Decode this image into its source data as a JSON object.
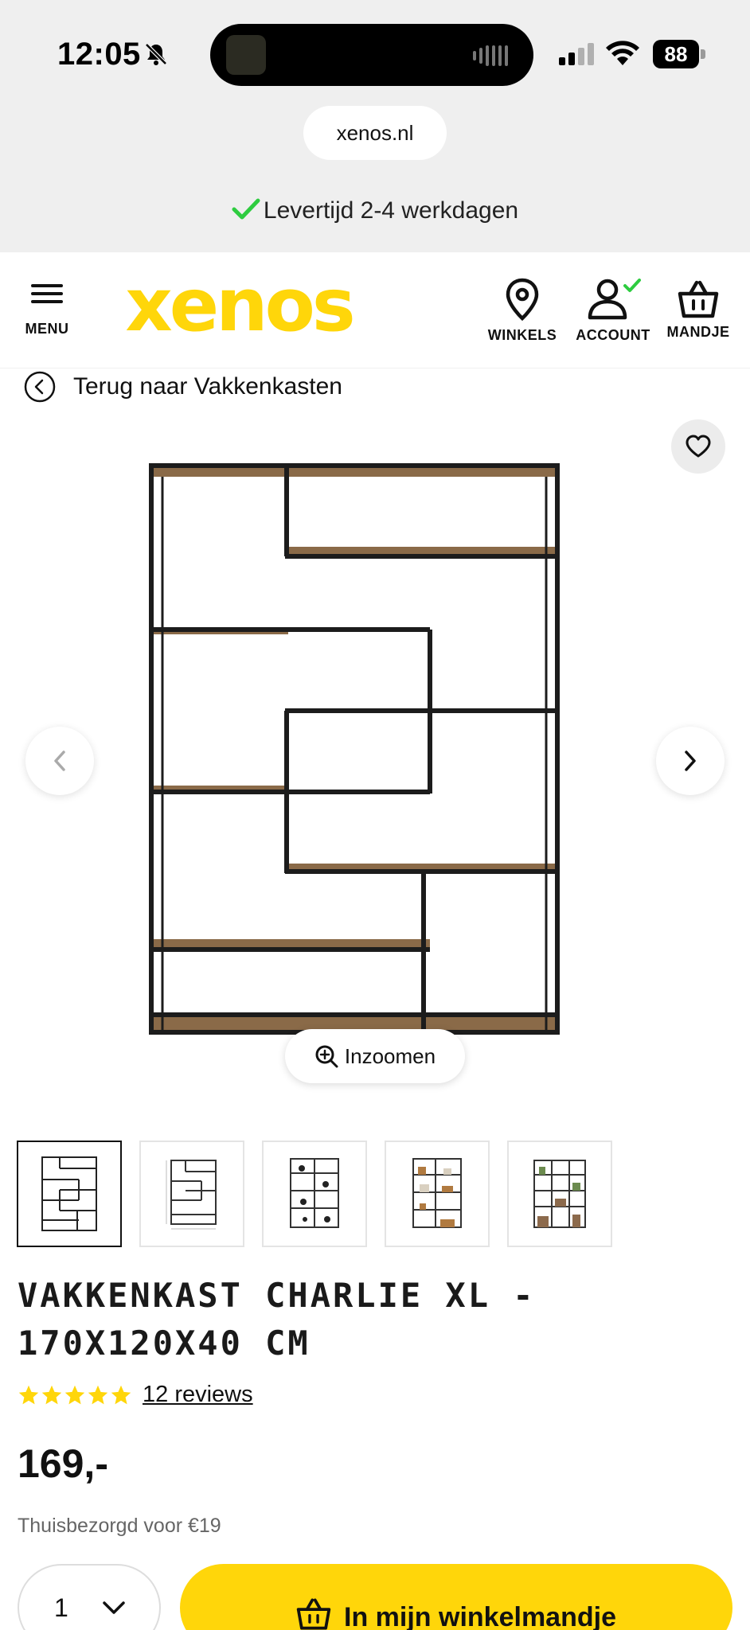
{
  "status_bar": {
    "time": "12:05",
    "battery": "88"
  },
  "browser": {
    "url": "xenos.nl"
  },
  "banner": {
    "delivery_text": "Levertijd 2-4 werkdagen"
  },
  "header": {
    "menu_label": "MENU",
    "logo_text": "xenos",
    "winkels_label": "WINKELS",
    "account_label": "ACCOUNT",
    "mandje_label": "MANDJE"
  },
  "breadcrumb": {
    "back_label": "Terug naar Vakkenkasten"
  },
  "gallery": {
    "zoom_label": "Inzoomen",
    "thumbnail_count": 5
  },
  "product": {
    "title": "VAKKENKAST CHARLIE XL - 170X120X40 CM",
    "rating_stars": 5,
    "reviews_label": "12 reviews",
    "price": "169,-",
    "shipping": "Thuisbezorgd voor €19"
  },
  "buy": {
    "quantity": "1",
    "cart_button_label": "In mijn winkelmandje"
  },
  "colors": {
    "brand_yellow": "#ffd60a",
    "check_green": "#2ecc40",
    "chrome_bg": "#efefef"
  }
}
